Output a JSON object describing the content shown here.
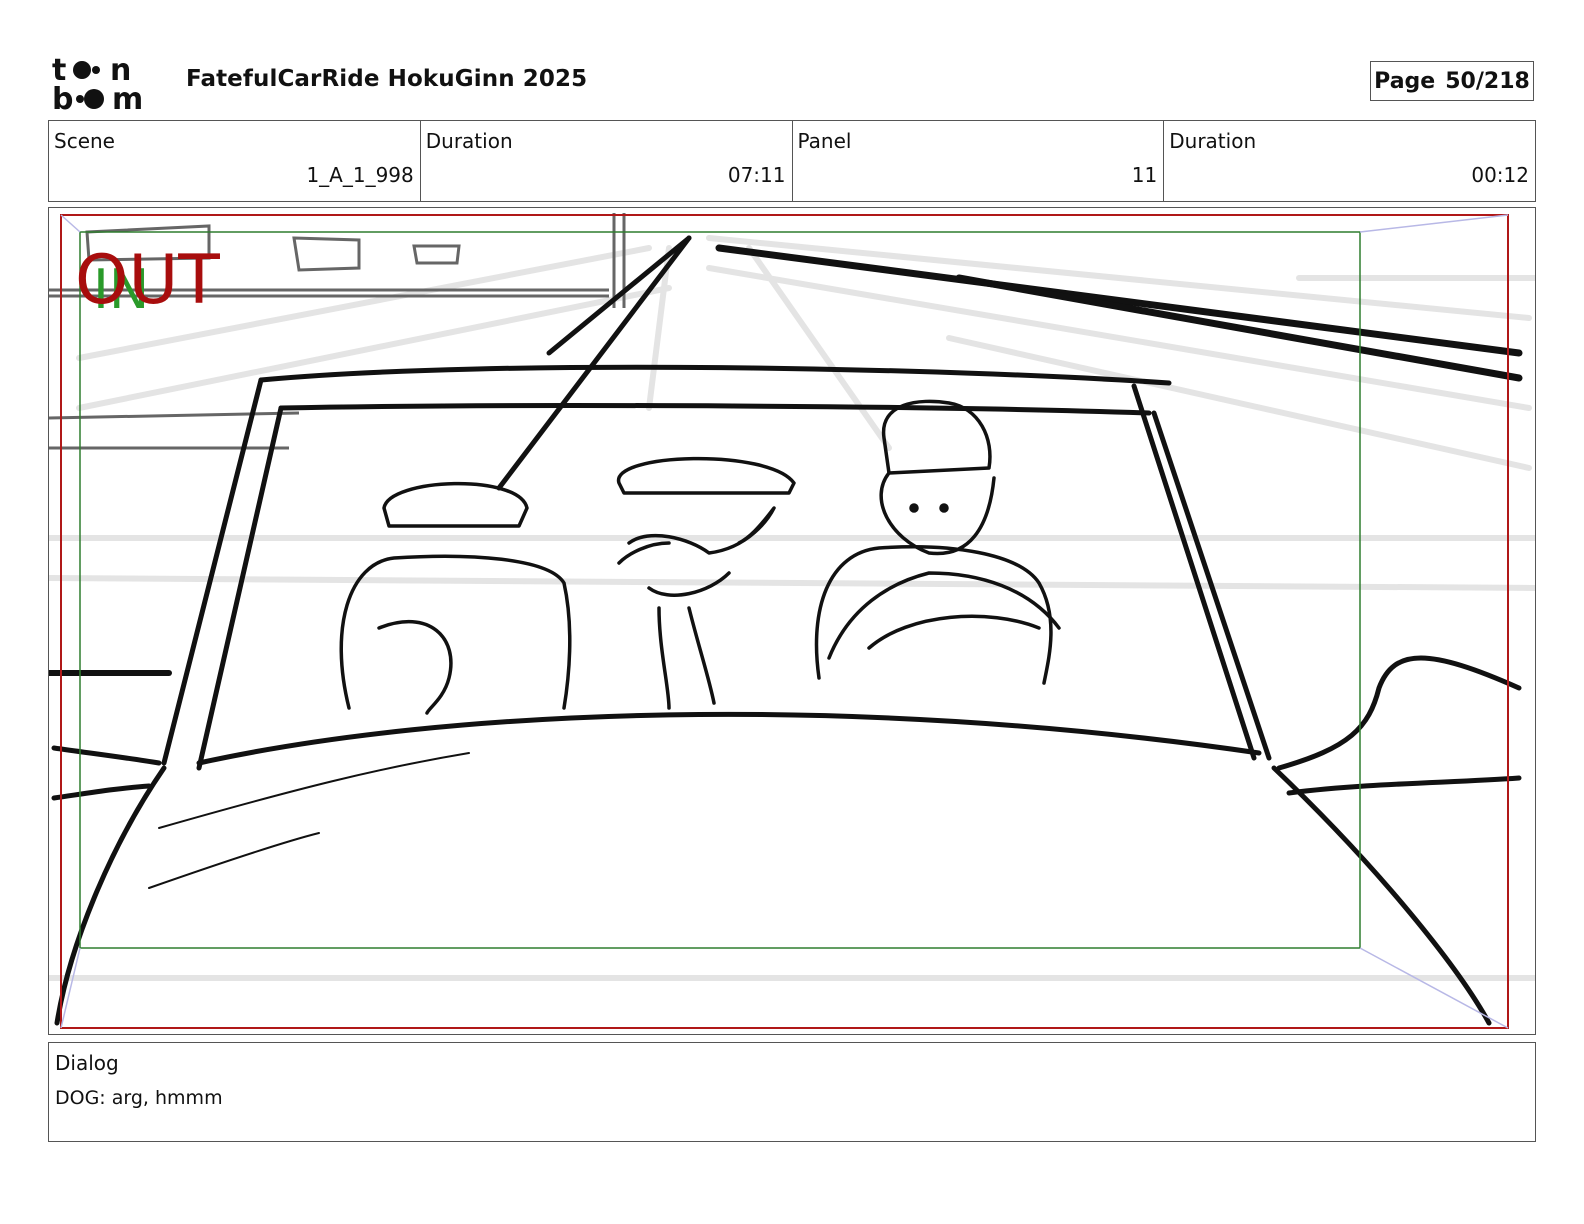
{
  "header": {
    "logo_text": "toonboom",
    "title": "FatefulCarRide HokuGinn 2025",
    "page_label": "Page",
    "page_value": "50/218"
  },
  "info": [
    {
      "label": "Scene",
      "value": "1_A_1_998"
    },
    {
      "label": "Duration",
      "value": "07:11"
    },
    {
      "label": "Panel",
      "value": "11"
    },
    {
      "label": "Duration",
      "value": "00:12"
    }
  ],
  "panel": {
    "out_marker": "OUT",
    "in_marker": "IN",
    "colors": {
      "out": "#a80d0d",
      "in": "#2a9a2a",
      "out_frame": "#b01818",
      "in_frame": "#2f7d2f"
    }
  },
  "dialog": {
    "label": "Dialog",
    "text": "DOG: arg, hmmm"
  }
}
